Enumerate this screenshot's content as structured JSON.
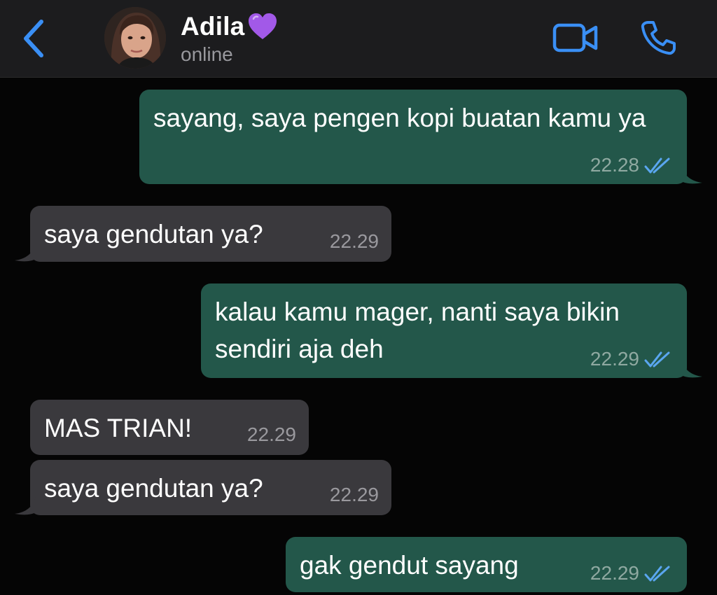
{
  "header": {
    "back_label": "‹",
    "contact_name": "Adila",
    "contact_status": "online",
    "icons": {
      "back": "chevron-left-icon",
      "heart": "purple-heart-icon",
      "video": "video-camera-icon",
      "call": "phone-icon"
    },
    "colors": {
      "accent": "#3a8ff5",
      "heart": "#a259e8",
      "header_bg": "#1c1c1e"
    }
  },
  "messages": [
    {
      "direction": "outgoing",
      "text": "sayang, saya pengen kopi buatan kamu ya",
      "time": "22.28",
      "status": "read"
    },
    {
      "direction": "incoming",
      "text": "saya gendutan ya?",
      "time": "22.29"
    },
    {
      "direction": "outgoing",
      "text": "kalau kamu mager, nanti saya bikin sendiri aja deh",
      "time": "22.29",
      "status": "read"
    },
    {
      "direction": "incoming",
      "text": "MAS TRIAN!",
      "time": "22.29"
    },
    {
      "direction": "incoming",
      "text": "saya gendutan ya?",
      "time": "22.29"
    },
    {
      "direction": "outgoing",
      "text": "gak gendut sayang",
      "time": "22.29",
      "status": "read"
    }
  ],
  "colors": {
    "background": "#050505",
    "outgoing_bubble": "#23574a",
    "incoming_bubble": "#3a393d",
    "read_ticks": "#5aa6f0"
  }
}
